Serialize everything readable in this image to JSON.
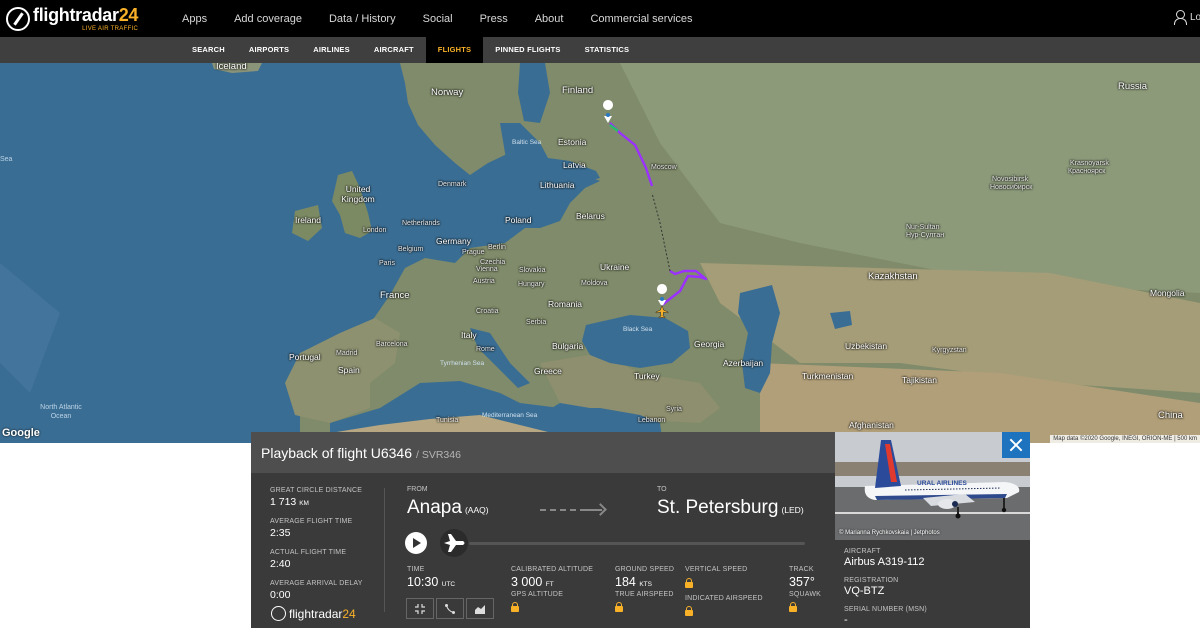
{
  "header": {
    "logo_name": "flightradar",
    "logo_num": "24",
    "logo_tagline": "LIVE AIR TRAFFIC",
    "nav": [
      "Apps",
      "Add coverage",
      "Data / History",
      "Social",
      "Press",
      "About",
      "Commercial services"
    ],
    "login_label": "Lo"
  },
  "subnav": [
    "SEARCH",
    "AIRPORTS",
    "AIRLINES",
    "AIRCRAFT",
    "FLIGHTS",
    "PINNED FLIGHTS",
    "STATISTICS"
  ],
  "map": {
    "labels": {
      "iceland": "Iceland",
      "norway": "Norway",
      "finland": "Finland",
      "russia": "Russia",
      "estonia": "Estonia",
      "latvia": "Latvia",
      "lithuania": "Lithuania",
      "uk": "United Kingdom",
      "ireland": "Ireland",
      "denmark": "Denmark",
      "netherlands": "Netherlands",
      "london": "London",
      "belgium": "Belgium",
      "germany": "Germany",
      "poland": "Poland",
      "belarus": "Belarus",
      "berlin": "Berlin",
      "prague": "Prague",
      "czechia": "Czechia",
      "paris": "Paris",
      "vienna": "Vienna",
      "slovakia": "Slovakia",
      "austria": "Austria",
      "hungary": "Hungary",
      "moldova": "Moldova",
      "france": "France",
      "ukraine": "Ukraine",
      "romania": "Romania",
      "croatia": "Croatia",
      "serbia": "Serbia",
      "bulgaria": "Bulgaria",
      "italy": "Italy",
      "rome": "Rome",
      "portugal": "Portugal",
      "madrid": "Madrid",
      "spain": "Spain",
      "barcelona": "Barcelona",
      "greece": "Greece",
      "turkey": "Turkey",
      "georgia": "Georgia",
      "azerbaijan": "Azerbaijan",
      "syria": "Syria",
      "lebanon": "Lebanon",
      "tunisia": "Tunisia",
      "kazakhstan": "Kazakhstan",
      "uzbekistan": "Uzbekistan",
      "turkmenistan": "Turkmenistan",
      "kyrgyzstan": "Kyrgyzstan",
      "tajikistan": "Tajikistan",
      "afghanistan": "Afghanistan",
      "mongolia": "Mongolia",
      "china": "China",
      "moscow": "Moscow",
      "nur_sultan": "Nur-Sultan",
      "nur_sultan_local": "Нур-Султан",
      "krasnoyarsk": "Krasnoyarsk",
      "krasnoyarsk_local": "Красноярск",
      "novosibirsk": "Novosibirsk",
      "novosibirsk_local": "Новосибирск",
      "baltic_sea": "Baltic Sea",
      "black_sea": "Black Sea",
      "tyrrhenian_sea": "Tyrrhenian Sea",
      "mediterranean_sea": "Mediterranean Sea",
      "north_atlantic": "North Atlantic Ocean",
      "sea_edge": "Sea"
    },
    "google_label": "Google",
    "attribution": "Map data ©2020 Google, INEGI, ORION-ME  |  500 km"
  },
  "playback": {
    "title": "Playback of flight U6346",
    "title_sub": "/ SVR346",
    "stats": [
      {
        "label": "GREAT CIRCLE DISTANCE",
        "value": "1 713",
        "unit": "KM"
      },
      {
        "label": "AVERAGE FLIGHT TIME",
        "value": "2:35",
        "unit": ""
      },
      {
        "label": "ACTUAL FLIGHT TIME",
        "value": "2:40",
        "unit": ""
      },
      {
        "label": "AVERAGE ARRIVAL DELAY",
        "value": "0:00",
        "unit": ""
      }
    ],
    "from_label": "FROM",
    "from_city": "Anapa",
    "from_code": "(AAQ)",
    "to_label": "TO",
    "to_city": "St. Petersburg",
    "to_code": "(LED)",
    "progress": 0.0,
    "metrics": {
      "time_label": "TIME",
      "time_value": "10:30",
      "time_unit": "UTC",
      "cal_alt_label": "CALIBRATED ALTITUDE",
      "cal_alt_value": "3 000",
      "cal_alt_unit": "FT",
      "gps_alt_label": "GPS ALTITUDE",
      "ground_speed_label": "GROUND SPEED",
      "ground_speed_value": "184",
      "ground_speed_unit": "KTS",
      "true_airspeed_label": "TRUE AIRSPEED",
      "vertical_speed_label": "VERTICAL SPEED",
      "indicated_airspeed_label": "INDICATED AIRSPEED",
      "track_label": "TRACK",
      "track_value": "357°",
      "squawk_label": "SQUAWK"
    },
    "footer_name": "flightradar",
    "footer_num": "24"
  },
  "aircraft": {
    "photo_credit": "© Marianna Rychkovskaia | Jetphotos",
    "livery_text": "URAL AIRLINES",
    "aircraft_label": "AIRCRAFT",
    "aircraft_value": "Airbus A319-112",
    "registration_label": "REGISTRATION",
    "registration_value": "VQ-BTZ",
    "msn_label": "SERIAL NUMBER (MSN)",
    "msn_value": "-"
  },
  "colors": {
    "accent": "#f9b128",
    "track": "#9b30ff",
    "close_button": "#1e73be"
  }
}
